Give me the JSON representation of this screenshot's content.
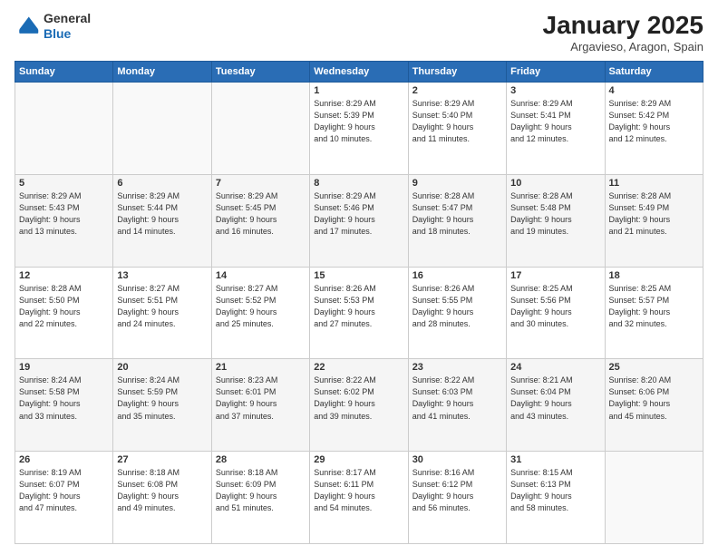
{
  "logo": {
    "line1": "General",
    "line2": "Blue"
  },
  "header": {
    "title": "January 2025",
    "subtitle": "Argavieso, Aragon, Spain"
  },
  "weekdays": [
    "Sunday",
    "Monday",
    "Tuesday",
    "Wednesday",
    "Thursday",
    "Friday",
    "Saturday"
  ],
  "weeks": [
    [
      {
        "day": "",
        "info": ""
      },
      {
        "day": "",
        "info": ""
      },
      {
        "day": "",
        "info": ""
      },
      {
        "day": "1",
        "info": "Sunrise: 8:29 AM\nSunset: 5:39 PM\nDaylight: 9 hours\nand 10 minutes."
      },
      {
        "day": "2",
        "info": "Sunrise: 8:29 AM\nSunset: 5:40 PM\nDaylight: 9 hours\nand 11 minutes."
      },
      {
        "day": "3",
        "info": "Sunrise: 8:29 AM\nSunset: 5:41 PM\nDaylight: 9 hours\nand 12 minutes."
      },
      {
        "day": "4",
        "info": "Sunrise: 8:29 AM\nSunset: 5:42 PM\nDaylight: 9 hours\nand 12 minutes."
      }
    ],
    [
      {
        "day": "5",
        "info": "Sunrise: 8:29 AM\nSunset: 5:43 PM\nDaylight: 9 hours\nand 13 minutes."
      },
      {
        "day": "6",
        "info": "Sunrise: 8:29 AM\nSunset: 5:44 PM\nDaylight: 9 hours\nand 14 minutes."
      },
      {
        "day": "7",
        "info": "Sunrise: 8:29 AM\nSunset: 5:45 PM\nDaylight: 9 hours\nand 16 minutes."
      },
      {
        "day": "8",
        "info": "Sunrise: 8:29 AM\nSunset: 5:46 PM\nDaylight: 9 hours\nand 17 minutes."
      },
      {
        "day": "9",
        "info": "Sunrise: 8:28 AM\nSunset: 5:47 PM\nDaylight: 9 hours\nand 18 minutes."
      },
      {
        "day": "10",
        "info": "Sunrise: 8:28 AM\nSunset: 5:48 PM\nDaylight: 9 hours\nand 19 minutes."
      },
      {
        "day": "11",
        "info": "Sunrise: 8:28 AM\nSunset: 5:49 PM\nDaylight: 9 hours\nand 21 minutes."
      }
    ],
    [
      {
        "day": "12",
        "info": "Sunrise: 8:28 AM\nSunset: 5:50 PM\nDaylight: 9 hours\nand 22 minutes."
      },
      {
        "day": "13",
        "info": "Sunrise: 8:27 AM\nSunset: 5:51 PM\nDaylight: 9 hours\nand 24 minutes."
      },
      {
        "day": "14",
        "info": "Sunrise: 8:27 AM\nSunset: 5:52 PM\nDaylight: 9 hours\nand 25 minutes."
      },
      {
        "day": "15",
        "info": "Sunrise: 8:26 AM\nSunset: 5:53 PM\nDaylight: 9 hours\nand 27 minutes."
      },
      {
        "day": "16",
        "info": "Sunrise: 8:26 AM\nSunset: 5:55 PM\nDaylight: 9 hours\nand 28 minutes."
      },
      {
        "day": "17",
        "info": "Sunrise: 8:25 AM\nSunset: 5:56 PM\nDaylight: 9 hours\nand 30 minutes."
      },
      {
        "day": "18",
        "info": "Sunrise: 8:25 AM\nSunset: 5:57 PM\nDaylight: 9 hours\nand 32 minutes."
      }
    ],
    [
      {
        "day": "19",
        "info": "Sunrise: 8:24 AM\nSunset: 5:58 PM\nDaylight: 9 hours\nand 33 minutes."
      },
      {
        "day": "20",
        "info": "Sunrise: 8:24 AM\nSunset: 5:59 PM\nDaylight: 9 hours\nand 35 minutes."
      },
      {
        "day": "21",
        "info": "Sunrise: 8:23 AM\nSunset: 6:01 PM\nDaylight: 9 hours\nand 37 minutes."
      },
      {
        "day": "22",
        "info": "Sunrise: 8:22 AM\nSunset: 6:02 PM\nDaylight: 9 hours\nand 39 minutes."
      },
      {
        "day": "23",
        "info": "Sunrise: 8:22 AM\nSunset: 6:03 PM\nDaylight: 9 hours\nand 41 minutes."
      },
      {
        "day": "24",
        "info": "Sunrise: 8:21 AM\nSunset: 6:04 PM\nDaylight: 9 hours\nand 43 minutes."
      },
      {
        "day": "25",
        "info": "Sunrise: 8:20 AM\nSunset: 6:06 PM\nDaylight: 9 hours\nand 45 minutes."
      }
    ],
    [
      {
        "day": "26",
        "info": "Sunrise: 8:19 AM\nSunset: 6:07 PM\nDaylight: 9 hours\nand 47 minutes."
      },
      {
        "day": "27",
        "info": "Sunrise: 8:18 AM\nSunset: 6:08 PM\nDaylight: 9 hours\nand 49 minutes."
      },
      {
        "day": "28",
        "info": "Sunrise: 8:18 AM\nSunset: 6:09 PM\nDaylight: 9 hours\nand 51 minutes."
      },
      {
        "day": "29",
        "info": "Sunrise: 8:17 AM\nSunset: 6:11 PM\nDaylight: 9 hours\nand 54 minutes."
      },
      {
        "day": "30",
        "info": "Sunrise: 8:16 AM\nSunset: 6:12 PM\nDaylight: 9 hours\nand 56 minutes."
      },
      {
        "day": "31",
        "info": "Sunrise: 8:15 AM\nSunset: 6:13 PM\nDaylight: 9 hours\nand 58 minutes."
      },
      {
        "day": "",
        "info": ""
      }
    ]
  ]
}
